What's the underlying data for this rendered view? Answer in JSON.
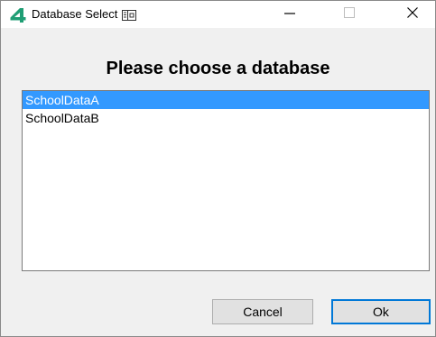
{
  "window": {
    "title": "Database Select"
  },
  "icons": {
    "app": "app-logo-4-icon",
    "title_extra": "window-panel-icon",
    "minimize": "minimize-icon",
    "maximize": "maximize-icon",
    "close": "close-icon"
  },
  "colors": {
    "app_icon": "#1f9e74",
    "selection": "#3399ff",
    "default_button_border": "#0078d7"
  },
  "dialog": {
    "heading": "Please choose a database",
    "databases": [
      {
        "label": "SchoolDataA",
        "selected": true
      },
      {
        "label": "SchoolDataB",
        "selected": false
      }
    ],
    "buttons": {
      "cancel": "Cancel",
      "ok": "Ok"
    }
  }
}
